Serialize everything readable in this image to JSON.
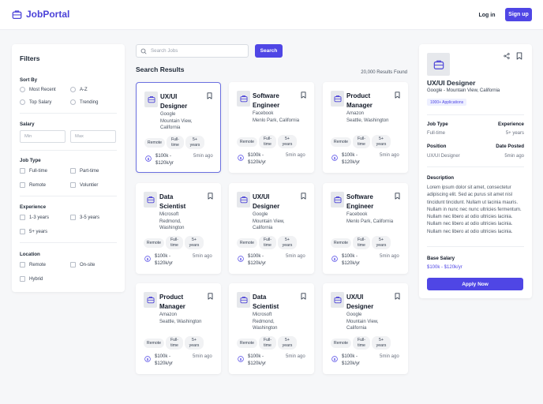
{
  "header": {
    "brand": "JobPortal",
    "login_label": "Log in",
    "signup_label": "Sign up",
    "brand_color": "#4b42d8"
  },
  "filters": {
    "title": "Filters",
    "sort_by": {
      "title": "Sort By",
      "options": [
        "Most Recent",
        "A-Z",
        "Top Salary",
        "Trending"
      ]
    },
    "salary": {
      "title": "Salary",
      "min_placeholder": "Min",
      "max_placeholder": "Max"
    },
    "job_type": {
      "title": "Job Type",
      "options": [
        "Full-time",
        "Part-time",
        "Remote",
        "Voluntier"
      ]
    },
    "experience": {
      "title": "Experience",
      "options": [
        "1-3 years",
        "3-5 years",
        "5+ years"
      ]
    },
    "location": {
      "title": "Location",
      "options": [
        "Remote",
        "On-site",
        "Hybrid"
      ]
    }
  },
  "search": {
    "placeholder": "Search Jobs",
    "button_label": "Search"
  },
  "results": {
    "title": "Search Results",
    "count_text": "20,000 Results Found"
  },
  "jobs": [
    {
      "title": "UX/UI Designer",
      "company": "Google",
      "location": "Mountain View, California",
      "tags": [
        "Remote",
        "Full-time",
        "5+ years"
      ],
      "salary": "$100k - $120k/yr",
      "posted": "5min ago",
      "selected": true
    },
    {
      "title": "Software Engineer",
      "company": "Facebook",
      "location": "Menlo Park, California",
      "tags": [
        "Remote",
        "Full-time",
        "5+ years"
      ],
      "salary": "$100k - $120k/yr",
      "posted": "5min ago",
      "selected": false
    },
    {
      "title": "Product Manager",
      "company": "Amazon",
      "location": "Seattle, Washington",
      "tags": [
        "Remote",
        "Full-time",
        "5+ years"
      ],
      "salary": "$100k - $120k/yr",
      "posted": "5min ago",
      "selected": false
    },
    {
      "title": "Data Scientist",
      "company": "Microsoft",
      "location": "Redmond, Washington",
      "tags": [
        "Remote",
        "Full-time",
        "5+ years"
      ],
      "salary": "$100k - $120k/yr",
      "posted": "5min ago",
      "selected": false
    },
    {
      "title": "UX/UI Designer",
      "company": "Google",
      "location": "Mountain View, California",
      "tags": [
        "Remote",
        "Full-time",
        "5+ years"
      ],
      "salary": "$100k - $120k/yr",
      "posted": "5min ago",
      "selected": false
    },
    {
      "title": "Software Engineer",
      "company": "Facebook",
      "location": "Menlo Park, California",
      "tags": [
        "Remote",
        "Full-time",
        "5+ years"
      ],
      "salary": "$100k - $120k/yr",
      "posted": "5min ago",
      "selected": false
    },
    {
      "title": "Product Manager",
      "company": "Amazon",
      "location": "Seattle, Washington",
      "tags": [
        "Remote",
        "Full-time",
        "5+ years"
      ],
      "salary": "$100k - $120k/yr",
      "posted": "5min ago",
      "selected": false
    },
    {
      "title": "Data Scientist",
      "company": "Microsoft",
      "location": "Redmond, Washington",
      "tags": [
        "Remote",
        "Full-time",
        "5+ years"
      ],
      "salary": "$100k - $120k/yr",
      "posted": "5min ago",
      "selected": false
    },
    {
      "title": "UX/UI Designer",
      "company": "Google",
      "location": "Mountain View, California",
      "tags": [
        "Remote",
        "Full-time",
        "5+ years"
      ],
      "salary": "$100k - $120k/yr",
      "posted": "5min ago",
      "selected": false
    }
  ],
  "details": {
    "title": "UX/UI Designer",
    "company_line": "Google - Mountain View, California",
    "badge": "1000+ Applications",
    "job_type_label": "Job Type",
    "job_type_value": "Full-time",
    "experience_label": "Experience",
    "experience_value": "5+ years",
    "position_label": "Position",
    "position_value": "UX/UI Designer",
    "date_label": "Date Posted",
    "date_value": "5min ago",
    "description_label": "Description",
    "description": "Lorem ipsum dolor sit amet, consectetur adipiscing elit. Sed ac purus sit amet nisl tincidunt tincidunt. Nullam ut lacinia mauris. Nullam in nunc nec nunc ultricies fermentum. Nullam nec libero at odio ultricies lacinia. Nullam nec libero at odio ultricies lacinia. Nullam nec libero at odio ultricies lacinia.",
    "base_salary_label": "Base Salary",
    "base_salary_value": "$100k - $120k/yr",
    "apply_label": "Apply Now"
  },
  "colors": {
    "accent": "#4f46e5",
    "background": "#f6f7f9"
  },
  "icons": {
    "logo": "briefcase-icon",
    "search": "search-icon",
    "bookmark": "bookmark-icon",
    "share": "share-icon",
    "salary": "dollar-icon"
  }
}
